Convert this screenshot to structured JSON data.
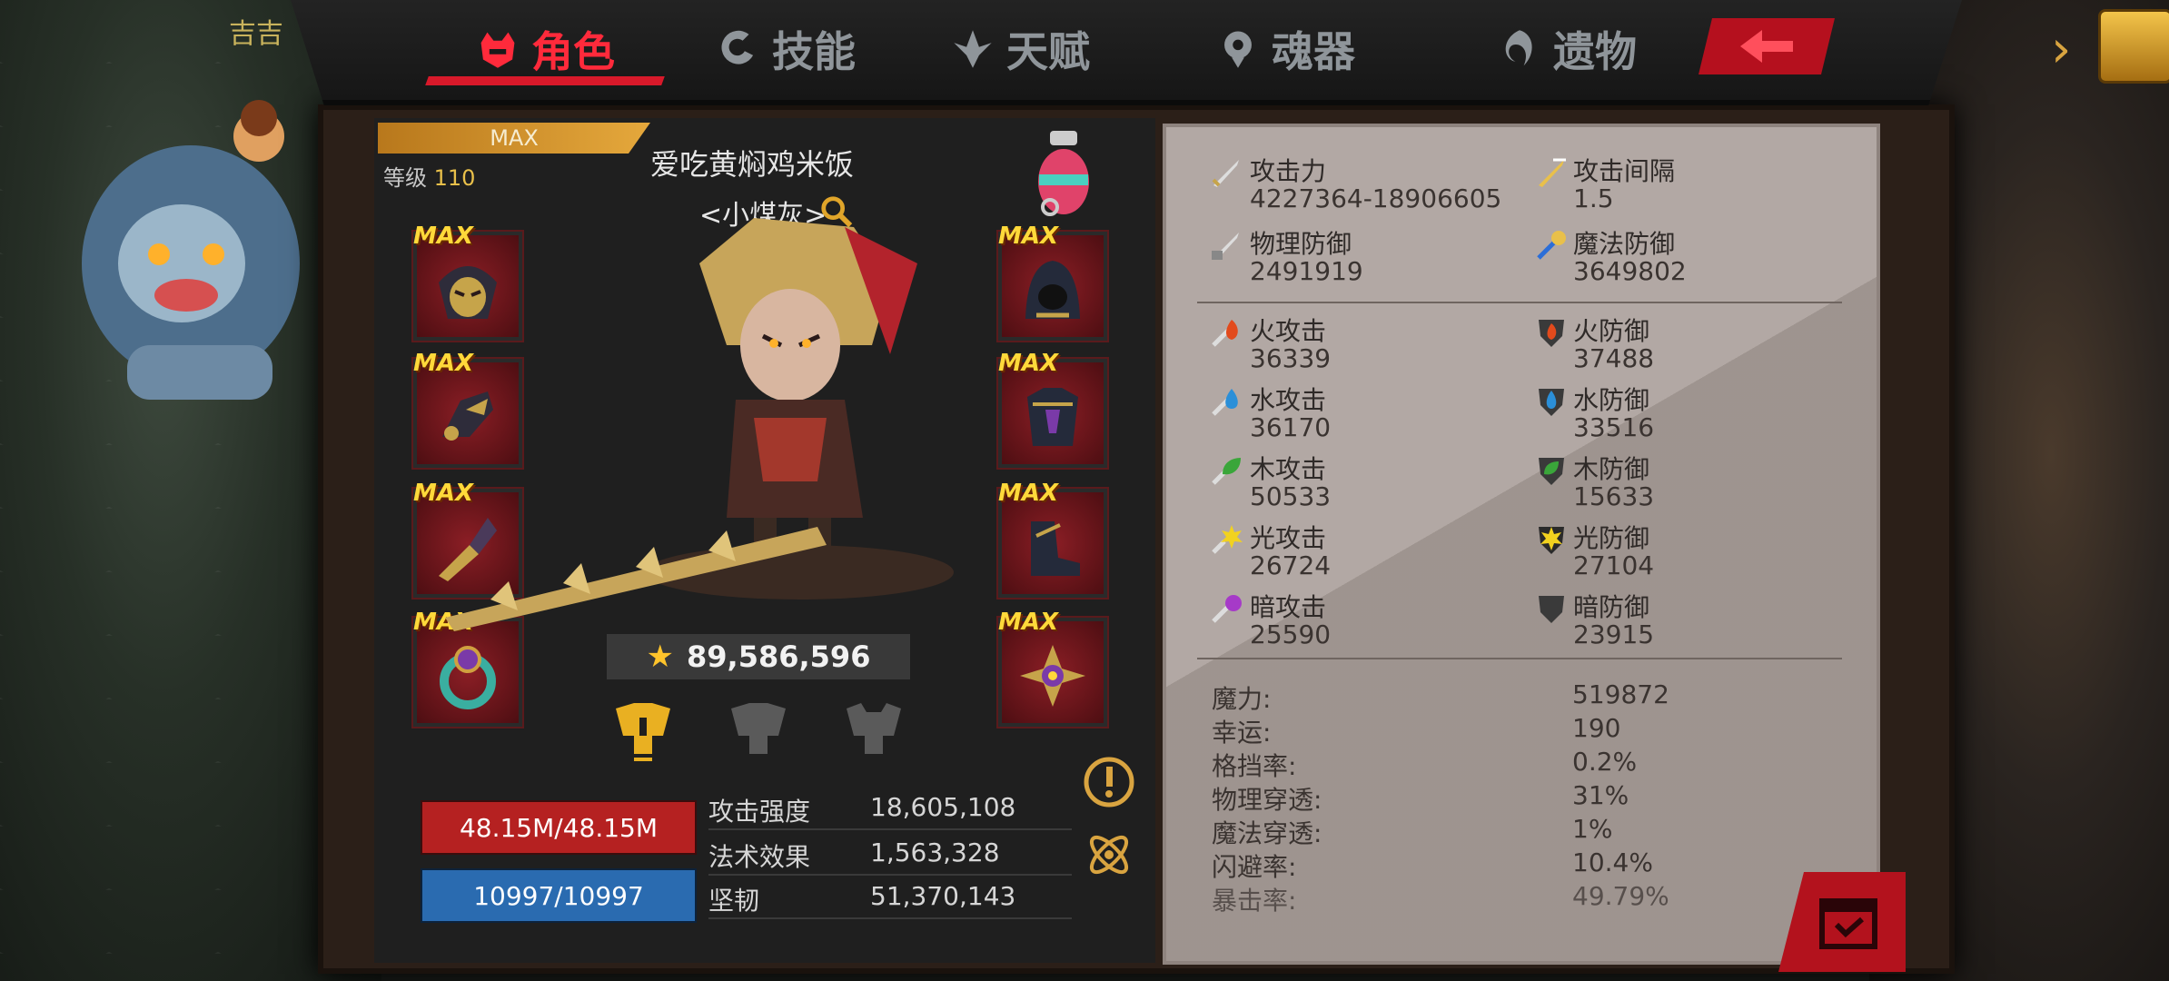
{
  "player": {
    "nickname": "吉吉"
  },
  "tabs": [
    {
      "label": "角色",
      "icon": "character-icon",
      "active": true
    },
    {
      "label": "技能",
      "icon": "skill-icon",
      "active": false
    },
    {
      "label": "天赋",
      "icon": "talent-icon",
      "active": false
    },
    {
      "label": "魂器",
      "icon": "soul-vessel-icon",
      "active": false
    },
    {
      "label": "遗物",
      "icon": "relic-icon",
      "active": false
    }
  ],
  "character": {
    "max_label": "MAX",
    "level_label": "等级",
    "level": "110",
    "name": "爱吃黄焖鸡米饭",
    "title": "<小煤灰>",
    "power": "89,586,596",
    "hp": "48.15M/48.15M",
    "mp": "10997/10997"
  },
  "equipment": {
    "slot_max_tag": "MAX",
    "left": [
      "helmet-mask-icon",
      "gauntlet-icon",
      "weapon-claw-icon",
      "ring-icon"
    ],
    "right": [
      "hood-icon",
      "chest-armor-icon",
      "boots-icon",
      "amulet-icon"
    ]
  },
  "summary_stats": [
    {
      "label": "攻击强度",
      "value": "18,605,108"
    },
    {
      "label": "法术效果",
      "value": "1,563,328"
    },
    {
      "label": "坚韧",
      "value": "51,370,143"
    }
  ],
  "attributes": {
    "top": [
      {
        "label": "攻击力",
        "value": "4227364-18906605",
        "icon": "sword-icon"
      },
      {
        "label": "攻击间隔",
        "value": "1.5",
        "icon": "attack-speed-icon"
      },
      {
        "label": "物理防御",
        "value": "2491919",
        "icon": "physical-defense-icon"
      },
      {
        "label": "魔法防御",
        "value": "3649802",
        "icon": "magic-defense-icon"
      }
    ],
    "elemental": [
      {
        "label": "火攻击",
        "value": "36339",
        "icon": "fire-attack-icon",
        "color": "#e24a1c"
      },
      {
        "label": "火防御",
        "value": "37488",
        "icon": "fire-defense-icon",
        "color": "#e24a1c"
      },
      {
        "label": "水攻击",
        "value": "36170",
        "icon": "water-attack-icon",
        "color": "#2b8fd8"
      },
      {
        "label": "水防御",
        "value": "33516",
        "icon": "water-defense-icon",
        "color": "#2b8fd8"
      },
      {
        "label": "木攻击",
        "value": "50533",
        "icon": "wood-attack-icon",
        "color": "#3aa63a"
      },
      {
        "label": "木防御",
        "value": "15633",
        "icon": "wood-defense-icon",
        "color": "#3aa63a"
      },
      {
        "label": "光攻击",
        "value": "26724",
        "icon": "light-attack-icon",
        "color": "#f2d21f"
      },
      {
        "label": "光防御",
        "value": "27104",
        "icon": "light-defense-icon",
        "color": "#f2d21f"
      },
      {
        "label": "暗攻击",
        "value": "25590",
        "icon": "dark-attack-icon",
        "color": "#a63ac8"
      },
      {
        "label": "暗防御",
        "value": "23915",
        "icon": "dark-defense-icon",
        "color": "#a63ac8"
      }
    ],
    "misc": [
      {
        "label": "魔力:",
        "value": "519872"
      },
      {
        "label": "幸运:",
        "value": "190"
      },
      {
        "label": "格挡率:",
        "value": "0.2%"
      },
      {
        "label": "物理穿透:",
        "value": "31%"
      },
      {
        "label": "魔法穿透:",
        "value": "1%"
      },
      {
        "label": "闪避率:",
        "value": "10.4%"
      },
      {
        "label": "暴击率:",
        "value": "49.79%"
      }
    ]
  },
  "colors": {
    "accent": "#d8192a",
    "panel": "#a79c97",
    "gold": "#e9c04a"
  }
}
